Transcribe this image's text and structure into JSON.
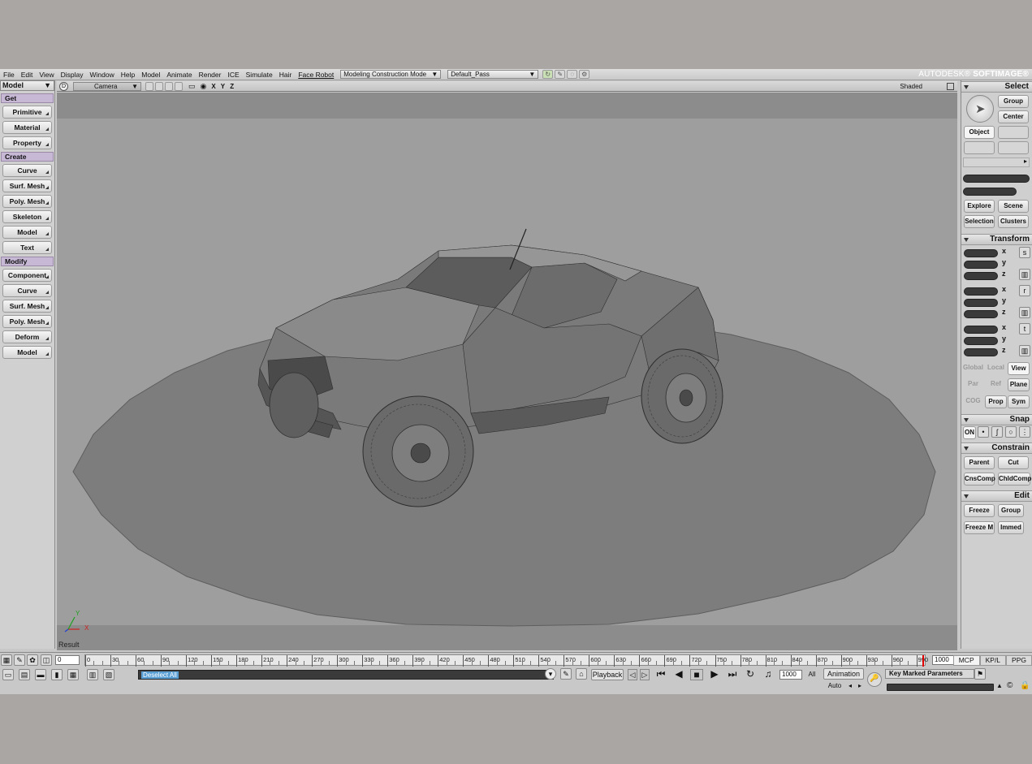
{
  "menubar": {
    "items": [
      "File",
      "Edit",
      "View",
      "Display",
      "Window",
      "Help",
      "Model",
      "Animate",
      "Render",
      "ICE",
      "Simulate",
      "Hair",
      "Face Robot"
    ],
    "mode_dropdown": "Modeling Construction Mode",
    "pass_dropdown": "Default_Pass",
    "brand_prefix": "AUTODESK®",
    "brand_name": "SOFTIMAGE®"
  },
  "left_panel": {
    "module": "Model",
    "get_label": "Get",
    "get_items": [
      "Primitive",
      "Material",
      "Property"
    ],
    "create_label": "Create",
    "create_items": [
      "Curve",
      "Surf. Mesh",
      "Poly. Mesh",
      "Skeleton",
      "Model",
      "Text"
    ],
    "modify_label": "Modify",
    "modify_items": [
      "Component",
      "Curve",
      "Surf. Mesh",
      "Poly. Mesh",
      "Deform",
      "Model"
    ]
  },
  "viewport": {
    "view_letter": "D",
    "camera": "Camera",
    "axes": "X Y Z",
    "display_mode": "Shaded",
    "status": "Result",
    "gizmo_y": "Y",
    "gizmo_x": "X"
  },
  "right_panel": {
    "select_title": "Select",
    "group": "Group",
    "center": "Center",
    "object": "Object",
    "explore": "Explore",
    "scene": "Scene",
    "selection": "Selection",
    "clusters": "Clusters",
    "transform_title": "Transform",
    "axes": [
      "x",
      "y",
      "z"
    ],
    "global": "Global",
    "local": "Local",
    "view": "View",
    "par": "Par",
    "ref": "Ref",
    "plane": "Plane",
    "cog": "COG",
    "prop": "Prop",
    "sym": "Sym",
    "snap_title": "Snap",
    "snap_on": "ON",
    "constrain_title": "Constrain",
    "parent": "Parent",
    "cut": "Cut",
    "cnscomp": "CnsComp",
    "chldcomp": "ChldComp",
    "edit_title": "Edit",
    "freeze": "Freeze",
    "edit_group": "Group",
    "freeze_m": "Freeze M",
    "immed": "Immed"
  },
  "timeline": {
    "start_frame": "0",
    "end_frame": "1000",
    "ticks": [
      "0",
      "30",
      "60",
      "90",
      "120",
      "150",
      "180",
      "210",
      "240",
      "270",
      "300",
      "330",
      "360",
      "390",
      "420",
      "450",
      "480",
      "510",
      "540",
      "570",
      "600",
      "630",
      "660",
      "690",
      "720",
      "750",
      "780",
      "810",
      "840",
      "870",
      "900",
      "930",
      "960",
      "990"
    ],
    "tabs": [
      "MCP",
      "KP/L",
      "PPG"
    ],
    "command": "Deselect All",
    "playback": "Playback",
    "frame_field": "1000",
    "all": "All",
    "animation": "Animation",
    "auto": "Auto",
    "key_marked": "Key Marked Parameters"
  },
  "colors": {
    "viewport_bg": "#9e9e9e",
    "ground_disc": "#7d7d7d",
    "section_header": "#c7b8d6",
    "panel_bg": "#cfcfcf"
  }
}
